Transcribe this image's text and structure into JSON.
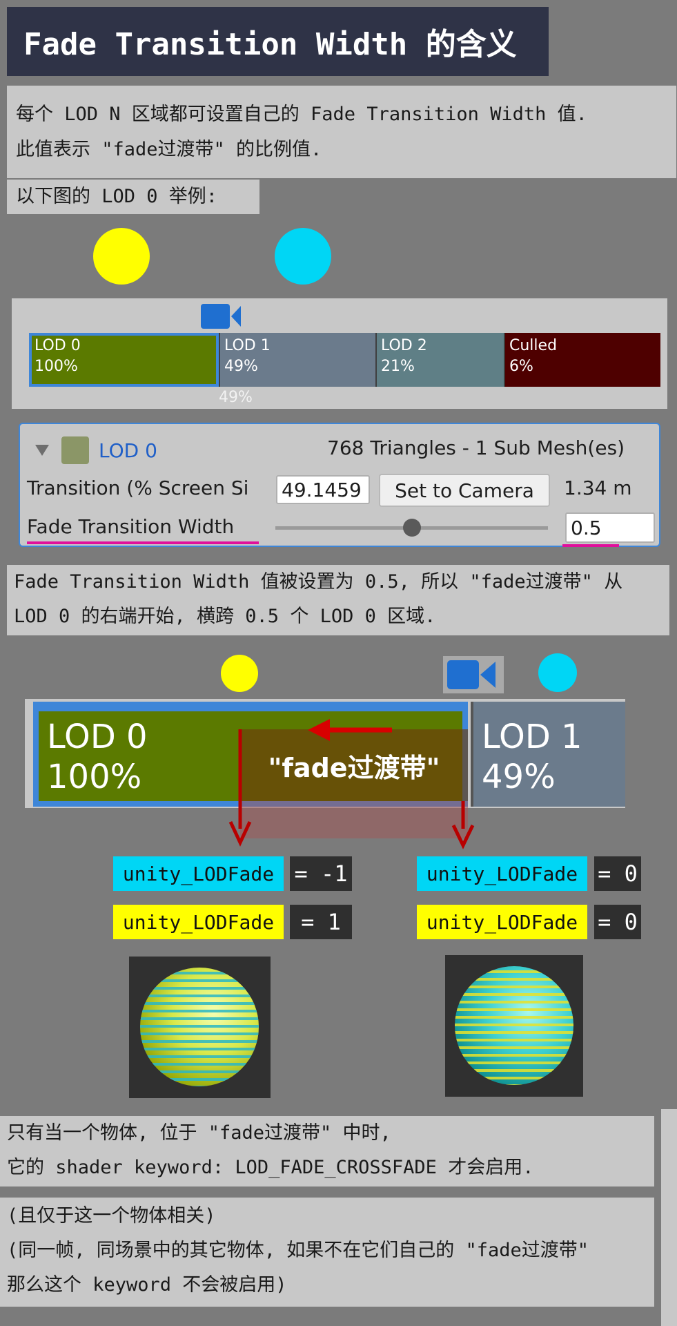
{
  "title": "Fade Transition Width 的含义",
  "intro": {
    "line1": "每个 LOD N 区域都可设置自己的 Fade Transition Width 值.",
    "line2": "此值表示 \"fade过渡带\" 的比例值.",
    "example": "以下图的 LOD 0 举例:"
  },
  "lod_bar": {
    "segments": [
      {
        "name": "LOD 0",
        "percent": "100%",
        "color": "#5b7a00"
      },
      {
        "name": "LOD 1",
        "percent": "49%",
        "color": "#6b7b8c"
      },
      {
        "name": "LOD 2",
        "percent": "21%",
        "color": "#5f7f86"
      },
      {
        "name": "Culled",
        "percent": "6%",
        "color": "#4e0000"
      }
    ],
    "camera_marker_label": "49%"
  },
  "inspector": {
    "lod_label": "LOD 0",
    "triangles": "768 Triangles  - 1 Sub Mesh(es)",
    "transition_label": "Transition (% Screen Si",
    "transition_value": "49.1459",
    "set_camera_button": "Set to Camera",
    "distance": "1.34 m",
    "fade_width_label": "Fade Transition Width",
    "fade_width_value": "0.5",
    "fade_slider_fraction": 0.5
  },
  "explanation": {
    "line1": "Fade Transition Width 值被设置为 0.5, 所以 \"fade过渡带\" 从",
    "line2": "LOD 0 的右端开始, 横跨 0.5 个 LOD 0 区域."
  },
  "zoom": {
    "lod0_name": "LOD 0",
    "lod0_percent": "100%",
    "lod1_name": "LOD 1",
    "lod1_percent": "49%",
    "fade_band_label": "\"fade过渡带\""
  },
  "values": {
    "left": {
      "cyan_label": "unity_LODFade",
      "cyan_value": "= -1",
      "yellow_label": "unity_LODFade",
      "yellow_value": "=  1"
    },
    "right": {
      "cyan_label": "unity_LODFade",
      "cyan_value": "= 0",
      "yellow_label": "unity_LODFade",
      "yellow_value": "= 0"
    }
  },
  "conclusion": {
    "line1": "只有当一个物体, 位于 \"fade过渡带\" 中时,",
    "line2": "它的 shader keyword: LOD_FADE_CROSSFADE 才会启用."
  },
  "footnote": {
    "line1": "(且仅于这一个物体相关)",
    "line2": "(同一帧, 同场景中的其它物体, 如果不在它们自己的 \"fade过渡带\"",
    "line3": "那么这个 keyword 不会被启用)"
  },
  "colors": {
    "yellow": "#ffff00",
    "cyan": "#00d6f5",
    "accent_blue": "#3e86d8",
    "magenta": "#e0109c",
    "arrow_red": "#d80000"
  },
  "icons": [
    "camera-icon",
    "foldout-triangle-icon",
    "lod-color-swatch-icon",
    "arrow-left-icon",
    "arrow-down-icon"
  ]
}
